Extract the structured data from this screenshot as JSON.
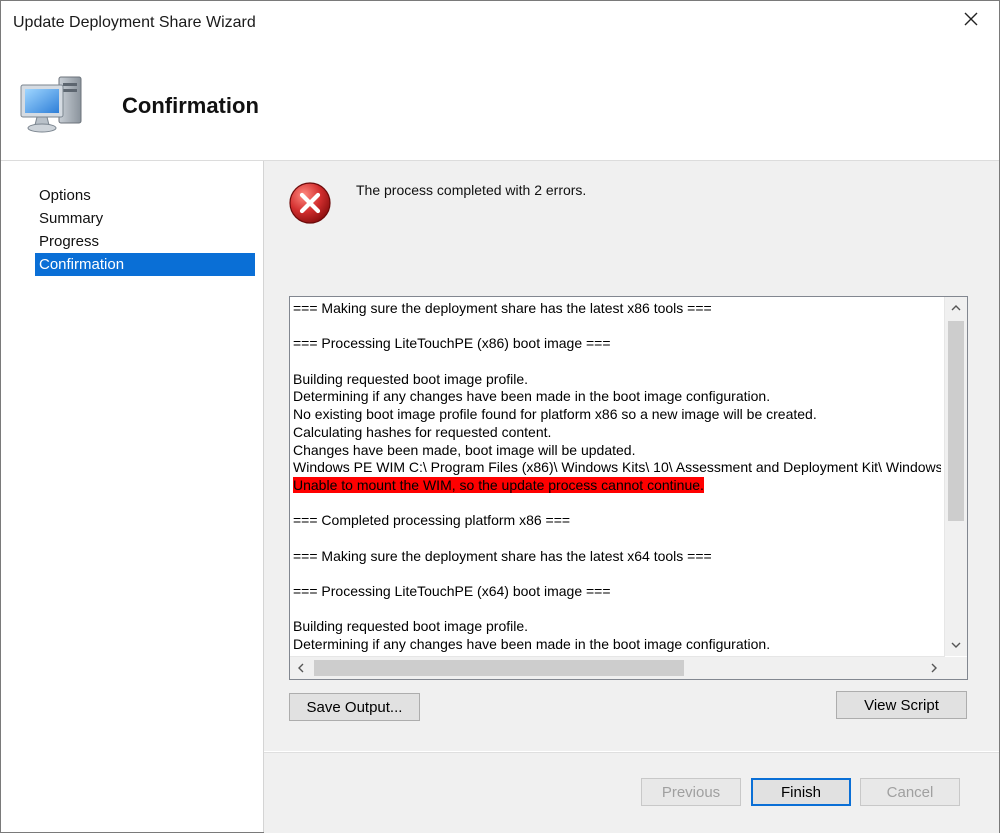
{
  "window": {
    "title": "Update Deployment Share Wizard"
  },
  "banner": {
    "title": "Confirmation",
    "icon": "computer-monitor-icon"
  },
  "sidebar": {
    "items": [
      {
        "label": "Options",
        "active": false
      },
      {
        "label": "Summary",
        "active": false
      },
      {
        "label": "Progress",
        "active": false
      },
      {
        "label": "Confirmation",
        "active": true
      }
    ]
  },
  "status": {
    "icon": "error-icon",
    "text": "The process completed with 2 errors."
  },
  "log": {
    "lines": [
      {
        "text": "=== Making sure the deployment share has the latest x86 tools ===",
        "error": false
      },
      {
        "text": "",
        "error": false
      },
      {
        "text": "=== Processing LiteTouchPE (x86) boot image ===",
        "error": false
      },
      {
        "text": "",
        "error": false
      },
      {
        "text": "Building requested boot image profile.",
        "error": false
      },
      {
        "text": "Determining if any changes have been made in the boot image configuration.",
        "error": false
      },
      {
        "text": "No existing boot image profile found for platform x86 so a new image will be created.",
        "error": false
      },
      {
        "text": "Calculating hashes for requested content.",
        "error": false
      },
      {
        "text": "Changes have been made, boot image will be updated.",
        "error": false
      },
      {
        "text": "Windows PE WIM C:\\ Program Files (x86)\\ Windows Kits\\ 10\\ Assessment and Deployment Kit\\ Windows",
        "error": false
      },
      {
        "text": "Unable to mount the WIM, so the update process cannot continue.",
        "error": true
      },
      {
        "text": "",
        "error": false
      },
      {
        "text": "=== Completed processing platform x86 ===",
        "error": false
      },
      {
        "text": "",
        "error": false
      },
      {
        "text": "=== Making sure the deployment share has the latest x64 tools ===",
        "error": false
      },
      {
        "text": "",
        "error": false
      },
      {
        "text": "=== Processing LiteTouchPE (x64) boot image ===",
        "error": false
      },
      {
        "text": "",
        "error": false
      },
      {
        "text": "Building requested boot image profile.",
        "error": false
      },
      {
        "text": "Determining if any changes have been made in the boot image configuration.",
        "error": false
      }
    ]
  },
  "buttons": {
    "save_output": "Save Output...",
    "view_script": "View Script",
    "previous": "Previous",
    "finish": "Finish",
    "cancel": "Cancel"
  },
  "colors": {
    "accent": "#0a6fd6",
    "error_highlight": "#ff0000"
  }
}
